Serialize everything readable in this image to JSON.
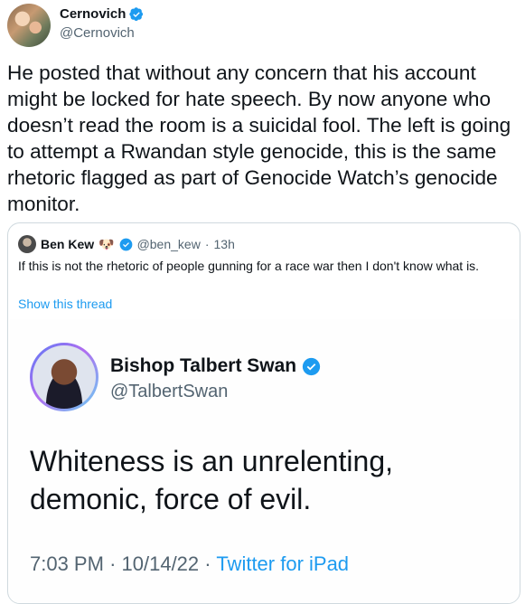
{
  "tweet": {
    "author_name": "Cernovich",
    "author_handle": "@Cernovich",
    "text": "He posted that without any concern that his account might be locked for hate speech. By now anyone who doesn’t read the room is a suicidal fool. The left is going to attempt a Rwandan style genocide, this is the same rhetoric flagged as part of Genocide Watch’s genocide monitor."
  },
  "quote": {
    "author_name": "Ben Kew",
    "author_emoji": "🐶",
    "author_handle": "@ben_kew",
    "separator": "·",
    "time": "13h",
    "text": "If this is not the rhetoric of people gunning for a race war then I don't know what is.",
    "show_thread": "Show this thread"
  },
  "screenshot": {
    "author_name": "Bishop Talbert Swan",
    "author_handle": "@TalbertSwan",
    "text": "Whiteness is an unrelenting, demonic, force of evil.",
    "time": "7:03 PM",
    "sep": "·",
    "date": "10/14/22",
    "source": "Twitter for iPad"
  },
  "colors": {
    "accent": "#1d9bf0",
    "muted": "#536471",
    "text": "#0f1419",
    "border": "#cfd9de"
  },
  "icons": {
    "verified": "verified-badge-icon"
  }
}
